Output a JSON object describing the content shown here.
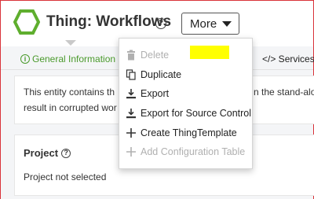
{
  "header": {
    "title": "Thing: Workflows",
    "help_icon": "question-circle-icon",
    "more_label": "More"
  },
  "tabs": {
    "general_label": "General Information",
    "services_label": "</> Services"
  },
  "description": {
    "line1_left": "This entity contains th",
    "line1_right": "n the stand-alo",
    "line2_left": "result in corrupted wor"
  },
  "project": {
    "title": "Project",
    "value": "Project not selected"
  },
  "menu": {
    "items": [
      {
        "label": "Delete",
        "icon": "trash-icon",
        "disabled": true
      },
      {
        "label": "Duplicate",
        "icon": "duplicate-icon",
        "disabled": false
      },
      {
        "label": "Export",
        "icon": "download-icon",
        "disabled": false
      },
      {
        "label": "Export for Source Control",
        "icon": "download-icon",
        "disabled": false
      },
      {
        "label": "Create ThingTemplate",
        "icon": "plus-icon",
        "disabled": false
      },
      {
        "label": "Add Configuration Table",
        "icon": "plus-icon",
        "disabled": true
      }
    ]
  },
  "colors": {
    "accent_green": "#4a9a2c",
    "frame_red": "#d9333a",
    "highlight_yellow": "#ffff00"
  }
}
